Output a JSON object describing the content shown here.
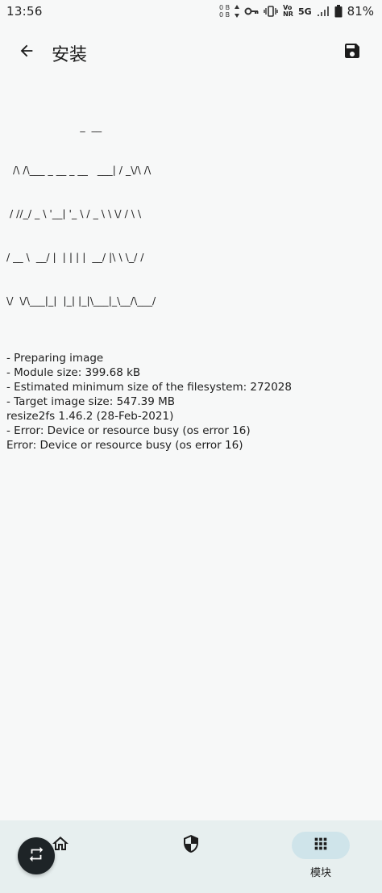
{
  "status_bar": {
    "time": "13:56",
    "net_up": "0 B",
    "net_down": "0 B",
    "vo_label": "Vo",
    "nr_label": "NR",
    "network_type": "5G",
    "battery_percent": "81%",
    "icons": [
      "key-icon",
      "vibrate-icon",
      "wifi-calling-icon",
      "signal-icon",
      "battery-icon"
    ]
  },
  "app_bar": {
    "title": "安装",
    "back_icon": "arrow-back-icon",
    "save_icon": "save-icon"
  },
  "console": {
    "ascii_art": [
      "                       _  __",
      "  /\\ /\\___ _ __ _ __   ___| / _\\/\\ /\\",
      " / //_/ _ \\ '__| '_ \\ / _ \\ \\ \\/ / \\ \\",
      "/ __ \\  __/ |  | | | |  __/ |\\ \\ \\_/ /",
      "\\/  \\/\\___|_|  |_| |_|\\___|_\\__/\\___/"
    ],
    "lines": [
      "- Preparing image",
      "- Module size: 399.68 kB",
      "- Estimated minimum size of the filesystem: 272028",
      "- Target image size: 547.39 MB",
      "resize2fs 1.46.2 (28-Feb-2021)",
      "- Error: Device or resource busy (os error 16)",
      "Error: Device or resource busy (os error 16)"
    ]
  },
  "bottom_nav": {
    "items": [
      {
        "id": "home",
        "icon": "home-icon",
        "label": ""
      },
      {
        "id": "superuser",
        "icon": "shield-icon",
        "label": ""
      },
      {
        "id": "modules",
        "icon": "apps-grid-icon",
        "label": "模块",
        "active": true
      }
    ]
  },
  "fab": {
    "icon": "repeat-icon"
  },
  "colors": {
    "background": "#f7f8f8",
    "nav_background": "#e7efef",
    "active_pill": "#cfe4ea",
    "fab": "#1e2427"
  }
}
